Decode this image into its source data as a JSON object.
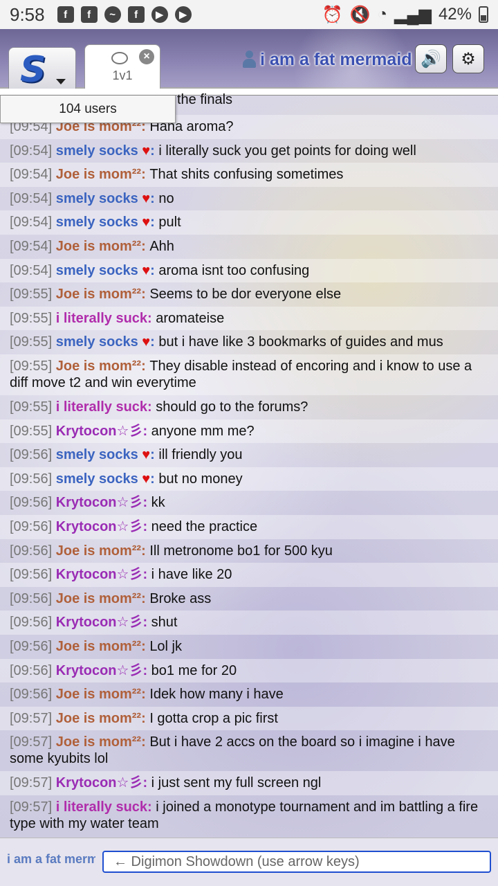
{
  "status_bar": {
    "time": "9:58",
    "battery": "42%",
    "left_icons": [
      "facebook-icon",
      "facebook-icon",
      "messenger-icon",
      "facebook-icon",
      "youtube-icon",
      "youtube-icon"
    ],
    "right_icons": [
      "alarm-icon",
      "mute-icon",
      "wifi-icon",
      "signal-icon",
      "battery-icon"
    ]
  },
  "header": {
    "tab_label": "1v1",
    "username": "i am a fat mermaid"
  },
  "users_count": "104 users",
  "partial_top_text": "the finals",
  "messages": [
    {
      "ts": "[09:54]",
      "user": "Joe is mom²²",
      "cls": "c-joe",
      "heart": false,
      "text": "Hana aroma?"
    },
    {
      "ts": "[09:54]",
      "user": "smely socks",
      "cls": "c-smely",
      "heart": true,
      "text": "i literally suck you get points for doing well"
    },
    {
      "ts": "[09:54]",
      "user": "Joe is mom²²",
      "cls": "c-joe",
      "heart": false,
      "text": "That shits confusing sometimes"
    },
    {
      "ts": "[09:54]",
      "user": "smely socks",
      "cls": "c-smely",
      "heart": true,
      "text": "no"
    },
    {
      "ts": "[09:54]",
      "user": "smely socks",
      "cls": "c-smely",
      "heart": true,
      "text": "pult"
    },
    {
      "ts": "[09:54]",
      "user": "Joe is mom²²",
      "cls": "c-joe",
      "heart": false,
      "text": "Ahh"
    },
    {
      "ts": "[09:54]",
      "user": "smely socks",
      "cls": "c-smely",
      "heart": true,
      "text": "aroma isnt too confusing"
    },
    {
      "ts": "[09:55]",
      "user": "Joe is mom²²",
      "cls": "c-joe",
      "heart": false,
      "text": "Seems to be dor everyone else"
    },
    {
      "ts": "[09:55]",
      "user": "i literally suck",
      "cls": "c-lit",
      "heart": false,
      "text": "aromateise"
    },
    {
      "ts": "[09:55]",
      "user": "smely socks",
      "cls": "c-smely",
      "heart": true,
      "text": "but i have like 3 bookmarks of guides and mus"
    },
    {
      "ts": "[09:55]",
      "user": "Joe is mom²²",
      "cls": "c-joe",
      "heart": false,
      "text": "They disable instead of encoring and i know to use a diff move t2 and win everytime"
    },
    {
      "ts": "[09:55]",
      "user": "i literally suck",
      "cls": "c-lit",
      "heart": false,
      "text": "should go to the forums?"
    },
    {
      "ts": "[09:55]",
      "user": "Krytocon☆彡",
      "cls": "c-kry",
      "heart": false,
      "text": "anyone mm me?"
    },
    {
      "ts": "[09:56]",
      "user": "smely socks",
      "cls": "c-smely",
      "heart": true,
      "text": "ill friendly you"
    },
    {
      "ts": "[09:56]",
      "user": "smely socks",
      "cls": "c-smely",
      "heart": true,
      "text": "but no money"
    },
    {
      "ts": "[09:56]",
      "user": "Krytocon☆彡",
      "cls": "c-kry",
      "heart": false,
      "text": "kk"
    },
    {
      "ts": "[09:56]",
      "user": "Krytocon☆彡",
      "cls": "c-kry",
      "heart": false,
      "text": "need the practice"
    },
    {
      "ts": "[09:56]",
      "user": "Joe is mom²²",
      "cls": "c-joe",
      "heart": false,
      "text": "Ill metronome bo1 for 500 kyu"
    },
    {
      "ts": "[09:56]",
      "user": "Krytocon☆彡",
      "cls": "c-kry",
      "heart": false,
      "text": "i have like 20"
    },
    {
      "ts": "[09:56]",
      "user": "Joe is mom²²",
      "cls": "c-joe",
      "heart": false,
      "text": "Broke ass"
    },
    {
      "ts": "[09:56]",
      "user": "Krytocon☆彡",
      "cls": "c-kry",
      "heart": false,
      "text": "shut"
    },
    {
      "ts": "[09:56]",
      "user": "Joe is mom²²",
      "cls": "c-joe",
      "heart": false,
      "text": "Lol jk"
    },
    {
      "ts": "[09:56]",
      "user": "Krytocon☆彡",
      "cls": "c-kry",
      "heart": false,
      "text": "bo1 me for 20"
    },
    {
      "ts": "[09:56]",
      "user": "Joe is mom²²",
      "cls": "c-joe",
      "heart": false,
      "text": "Idek how many i have"
    },
    {
      "ts": "[09:57]",
      "user": "Joe is mom²²",
      "cls": "c-joe",
      "heart": false,
      "text": "I gotta crop a pic first"
    },
    {
      "ts": "[09:57]",
      "user": "Joe is mom²²",
      "cls": "c-joe",
      "heart": false,
      "text": "But i have 2 accs on the board so i imagine i have some kyubits lol"
    },
    {
      "ts": "[09:57]",
      "user": "Krytocon☆彡",
      "cls": "c-kry",
      "heart": false,
      "text": "i just sent my full screen ngl"
    },
    {
      "ts": "[09:57]",
      "user": "i literally suck",
      "cls": "c-lit",
      "heart": false,
      "text": "i joined a monotype tournament and im battling a fire type with my water team"
    }
  ],
  "footer": {
    "username": "i am a fat mermaid",
    "input_placeholder": "← Digimon Showdown (use arrow keys)"
  },
  "colors": {
    "accent_blue": "#1e4fd0",
    "smely": "#3b64c0",
    "joe": "#b0603a",
    "literally": "#b02dab",
    "krytocon": "#9a2cb4"
  }
}
